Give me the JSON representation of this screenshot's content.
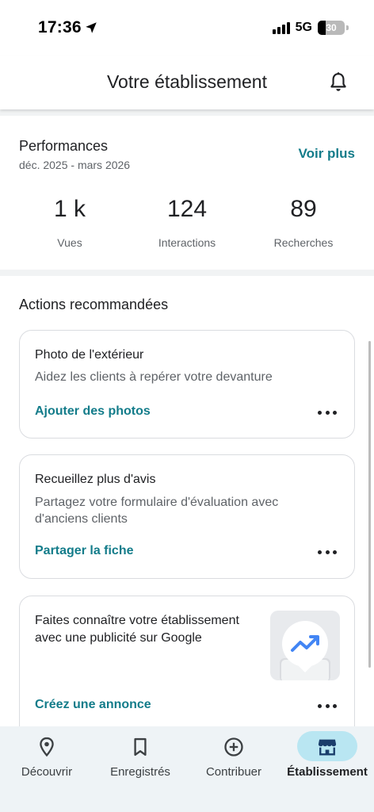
{
  "status_bar": {
    "time": "17:36",
    "network": "5G",
    "battery": "30",
    "battery_level": 0.3
  },
  "header": {
    "title": "Votre établissement",
    "bell_icon": "bell-icon"
  },
  "performance": {
    "title": "Performances",
    "period": "déc. 2025 - mars 2026",
    "more_label": "Voir plus",
    "stats": [
      {
        "value": "1 k",
        "label": "Vues"
      },
      {
        "value": "124",
        "label": "Interactions"
      },
      {
        "value": "89",
        "label": "Recherches"
      }
    ]
  },
  "recommended": {
    "title": "Actions recommandées",
    "cards": [
      {
        "title": "Photo de l'extérieur",
        "description": "Aidez les clients à repérer votre devanture",
        "action": "Ajouter des photos"
      },
      {
        "title": "Recueillez plus d'avis",
        "description": "Partagez votre formulaire d'évaluation avec d'anciens clients",
        "action": "Partager la fiche"
      },
      {
        "title": "Faites connaître votre établissement avec une publicité sur Google",
        "action": "Créez une annonce",
        "image_icon": "trending-up-icon"
      }
    ]
  },
  "bottom_nav": {
    "items": [
      {
        "label": "Découvrir",
        "icon": "location-pin-icon"
      },
      {
        "label": "Enregistrés",
        "icon": "bookmark-icon"
      },
      {
        "label": "Contribuer",
        "icon": "add-circle-icon"
      },
      {
        "label": "Établissement",
        "icon": "storefront-icon",
        "active": true
      }
    ]
  },
  "colors": {
    "accent": "#137c8a",
    "active_pill": "#b9e6f2",
    "nav_background": "#eef3f6"
  }
}
